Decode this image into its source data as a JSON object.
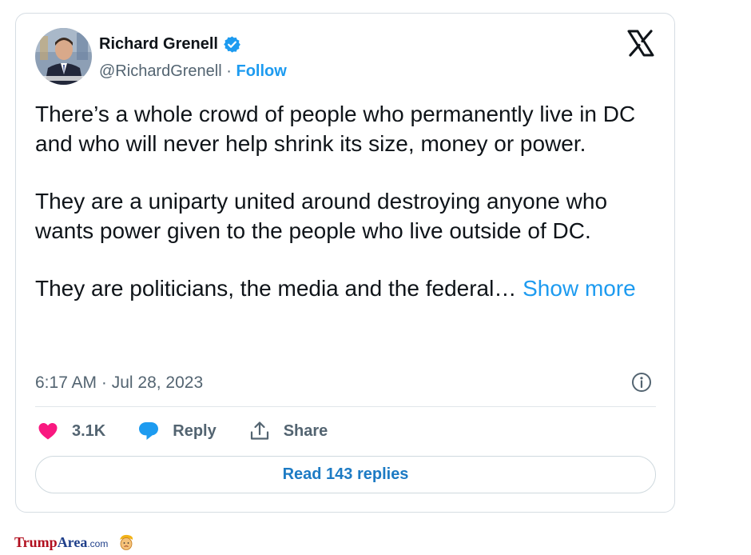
{
  "author": {
    "name": "Richard Grenell",
    "handle": "@RichardGrenell",
    "separator": " · ",
    "follow_label": "Follow"
  },
  "tweet": {
    "paragraphs": [
      "There’s a whole crowd of people who permanently live in DC and who will never help shrink its size, money or power.",
      "They are a uniparty united around destroying anyone who wants power given to the people who live outside of DC.",
      "They are politicians, the media and the federal… "
    ],
    "show_more_label": "Show more",
    "timestamp": "6:17 AM · Jul 28, 2023"
  },
  "actions": {
    "likes_count": "3.1K",
    "reply_label": "Reply",
    "share_label": "Share"
  },
  "read_replies_label": "Read 143 replies",
  "watermark": {
    "part1": "Trump",
    "part2": "Area",
    "part3": ".com"
  },
  "icons": {
    "verified": "verified-badge-icon",
    "platform": "x-logo-icon",
    "info": "info-icon",
    "like": "heart-icon",
    "reply": "speech-bubble-icon",
    "share": "share-upload-icon"
  },
  "colors": {
    "accent": "#1d9bf0",
    "like": "#f91880",
    "text": "#0f1419",
    "muted": "#536471"
  }
}
